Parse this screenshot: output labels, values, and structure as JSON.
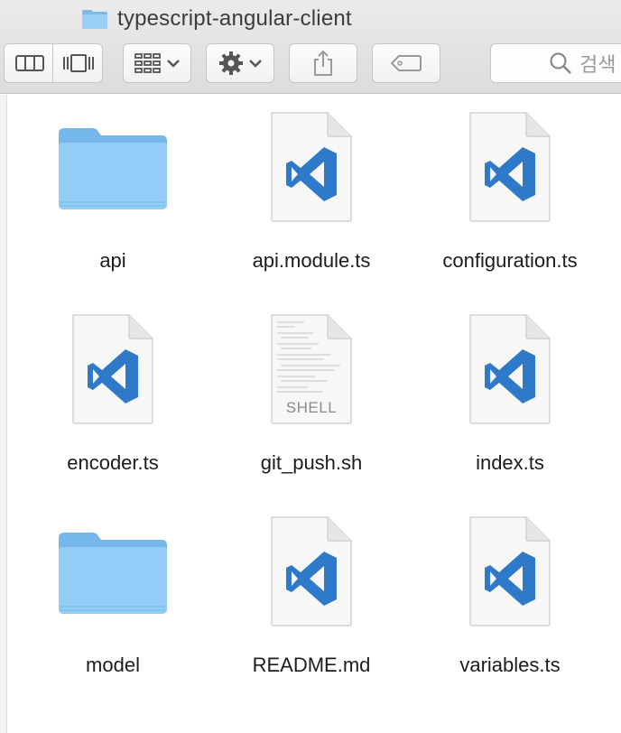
{
  "window": {
    "title": "typescript-angular-client"
  },
  "toolbar": {
    "search_placeholder": "검색"
  },
  "files": [
    {
      "name": "api",
      "kind": "folder"
    },
    {
      "name": "api.module.ts",
      "kind": "vscode"
    },
    {
      "name": "configuration.ts",
      "kind": "vscode"
    },
    {
      "name": "encoder.ts",
      "kind": "vscode"
    },
    {
      "name": "git_push.sh",
      "kind": "shell",
      "badge": "SHELL"
    },
    {
      "name": "index.ts",
      "kind": "vscode"
    },
    {
      "name": "model",
      "kind": "folder"
    },
    {
      "name": "README.md",
      "kind": "vscode"
    },
    {
      "name": "variables.ts",
      "kind": "vscode"
    }
  ],
  "colors": {
    "folder": "#8cc8f2",
    "vscode_blue": "#2f7ac8"
  }
}
